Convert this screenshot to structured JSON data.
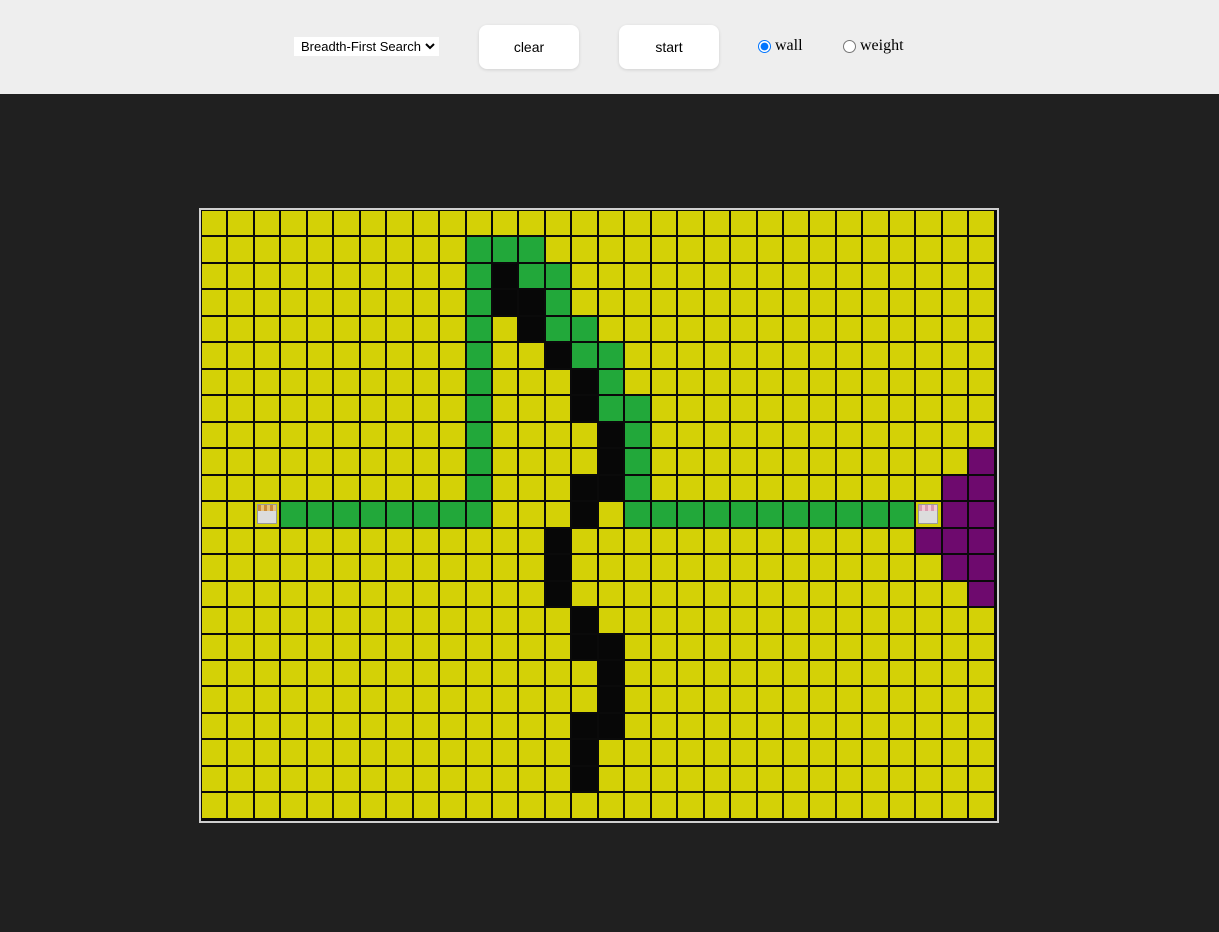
{
  "toolbar": {
    "algorithm_selected": "Breadth-First Search",
    "clear_label": "clear",
    "start_label": "start",
    "wall_label": "wall",
    "weight_label": "weight",
    "selected_mode": "wall"
  },
  "grid": {
    "rows": [
      "..............................",
      "..........PPP.................",
      "..........PWPP................",
      "..........PWWP................",
      "..........P.WPP...............",
      "..........P..WPP..............",
      "..........P...WP..............",
      "..........P...WPP.............",
      "..........P....WP.............",
      "..........P....WP............V",
      "..........P...WWP...........VV",
      "..SPPPPPPPP...W.PPPPPPPPPPPEVV",
      ".............W.............VVV",
      ".............W..............VV",
      ".............W...............V",
      "..............W...............",
      "..............WW..............",
      "...............W..............",
      "...............W..............",
      "..............WW..............",
      "..............W...............",
      "..............W...............",
      ".............................."
    ],
    "legend": {
      "empty": ".",
      "path": "P",
      "wall": "W",
      "visited": "V",
      "start": "S",
      "end": "E"
    },
    "colors": {
      "empty": "#d4d106",
      "path": "#22a83a",
      "wall": "#070707",
      "visited": "#6e0a6e",
      "background": "#202020",
      "toolbar": "#eeeeee"
    }
  }
}
